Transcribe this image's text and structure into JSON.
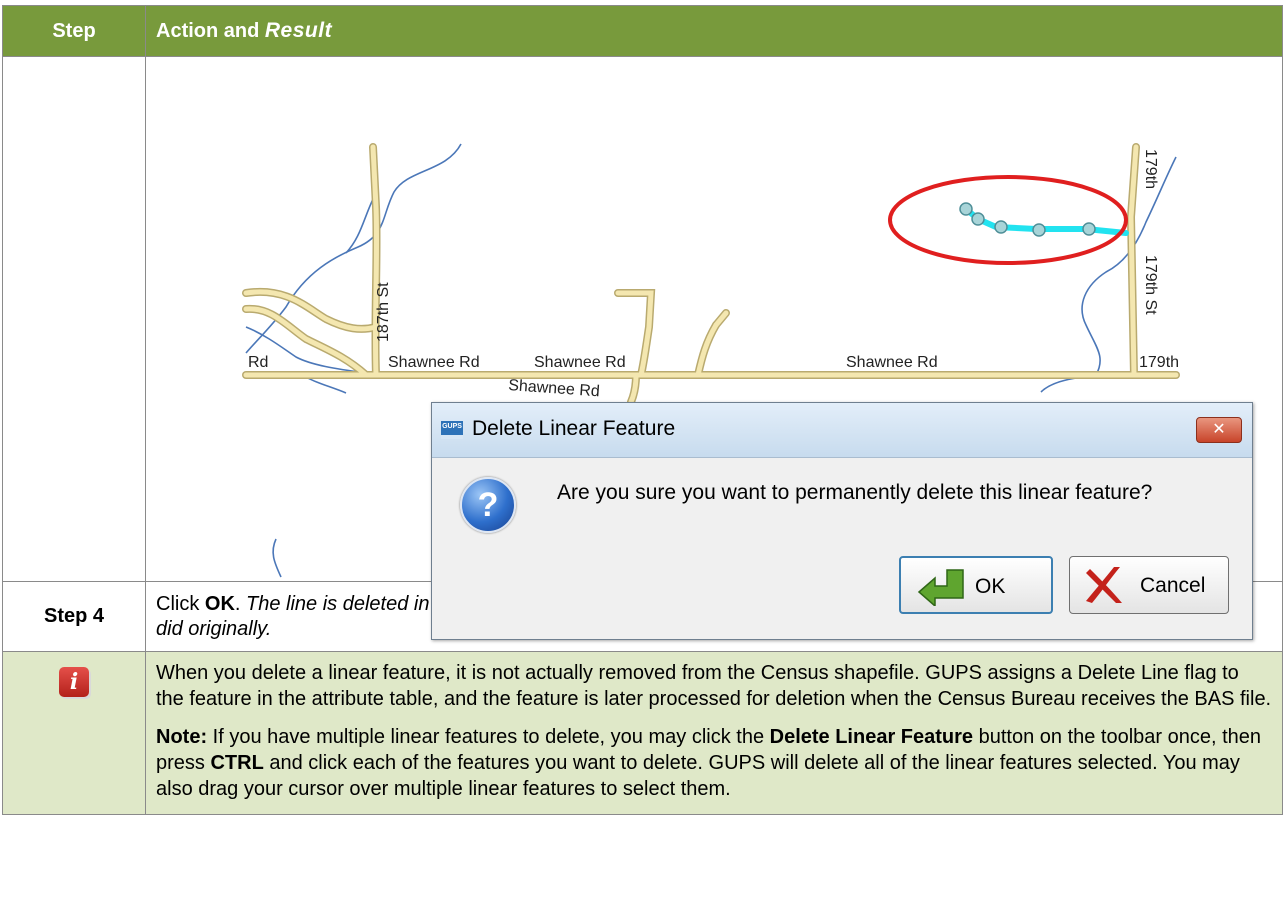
{
  "header": {
    "step_label": "Step",
    "action_label": "Action and ",
    "action_italic": "Result"
  },
  "map": {
    "road_labels": [
      "Rd",
      "Shawnee Rd",
      "Shawnee Rd",
      "Shawnee Rd",
      "Shawnee Rd",
      "179th",
      "187th St",
      "179th St",
      "179th"
    ],
    "colors": {
      "road": "#f4e7b0",
      "road_edge": "#b9aa6f",
      "water": "#4b77b8",
      "selected_line": "#22e3f0",
      "vertex": "#a8d4d8",
      "highlight_ellipse": "#e01f1f"
    }
  },
  "dialog": {
    "title": "Delete Linear Feature",
    "app_icon": "GUPS",
    "close_glyph": "✕",
    "question_glyph": "?",
    "message": "Are you sure you want to permanently delete this linear feature?",
    "ok_label": "OK",
    "cancel_label": "Cancel"
  },
  "step": {
    "number": "Step 4",
    "click": "Click ",
    "ok": "OK",
    "rest": ". ",
    "result": "The line is deleted in the attribute table",
    "rest2": ". ",
    "result2": "The cyan blue color is removed from the line and the line now looks as it did originally."
  },
  "note": {
    "info_glyph": "i",
    "para1": "When you delete a linear feature, it is not actually removed from the Census shapefile. GUPS assigns a Delete Line flag to the feature in the attribute table, and the feature is later processed for deletion when the Census Bureau receives the BAS file.",
    "note_label": "Note:",
    "p2a": "  If you have multiple linear features to delete, you may click the ",
    "p2b": "Delete Linear Feature",
    "p2c": " button on the toolbar once, then press ",
    "p2d": "CTRL",
    "p2e": " and click each of the features you want to delete. GUPS will delete all of the linear features selected. You may also drag your cursor over multiple linear features to select them."
  }
}
